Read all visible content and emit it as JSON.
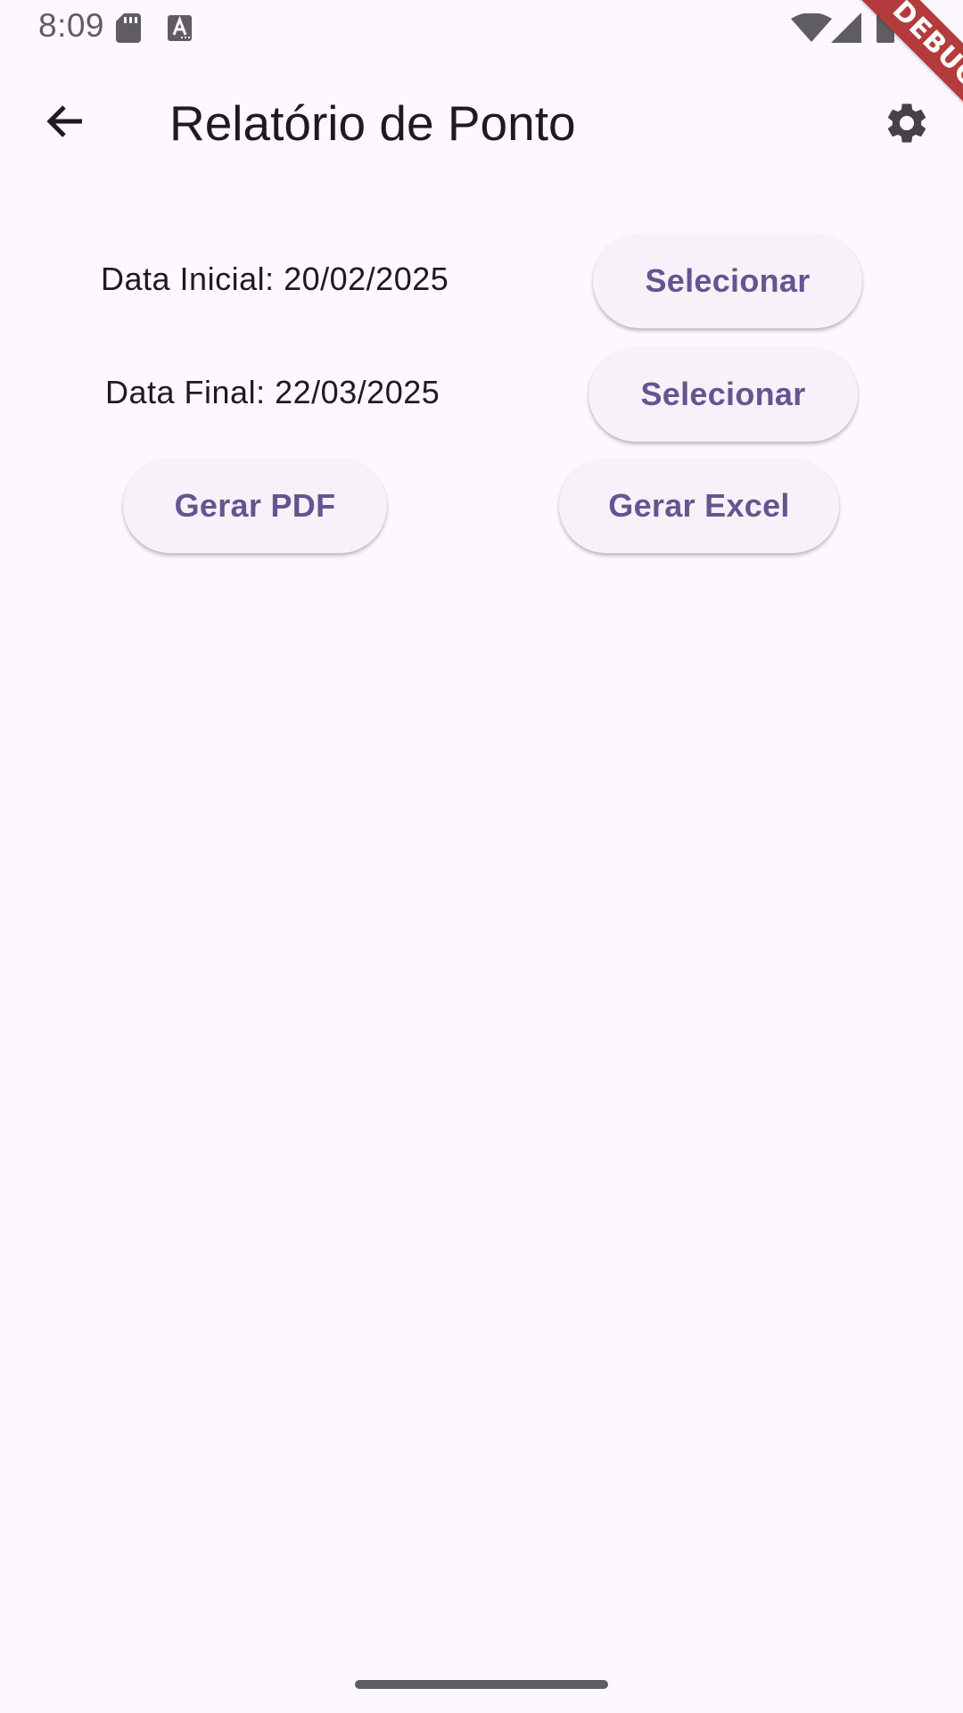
{
  "status_bar": {
    "time": "8:09",
    "icons": [
      "sd-card-icon",
      "a-notification-icon",
      "wifi-icon",
      "signal-icon",
      "battery-icon"
    ]
  },
  "debug_banner": {
    "label": "DEBUG",
    "color": "#b33b3b"
  },
  "app_bar": {
    "title": "Relatório de Ponto",
    "back_icon": "arrow-back-icon",
    "settings_icon": "gear-icon"
  },
  "form": {
    "start_date": {
      "label": "Data Inicial: 20/02/2025",
      "button_label": "Selecionar"
    },
    "end_date": {
      "label": "Data Final: 22/03/2025",
      "button_label": "Selecionar"
    }
  },
  "actions": {
    "pdf_label": "Gerar PDF",
    "excel_label": "Gerar Excel"
  },
  "theme": {
    "background": "#fdf7fe",
    "button_surface": "#f7f2fa",
    "accent": "#65558f",
    "text": "#1d1b20"
  }
}
